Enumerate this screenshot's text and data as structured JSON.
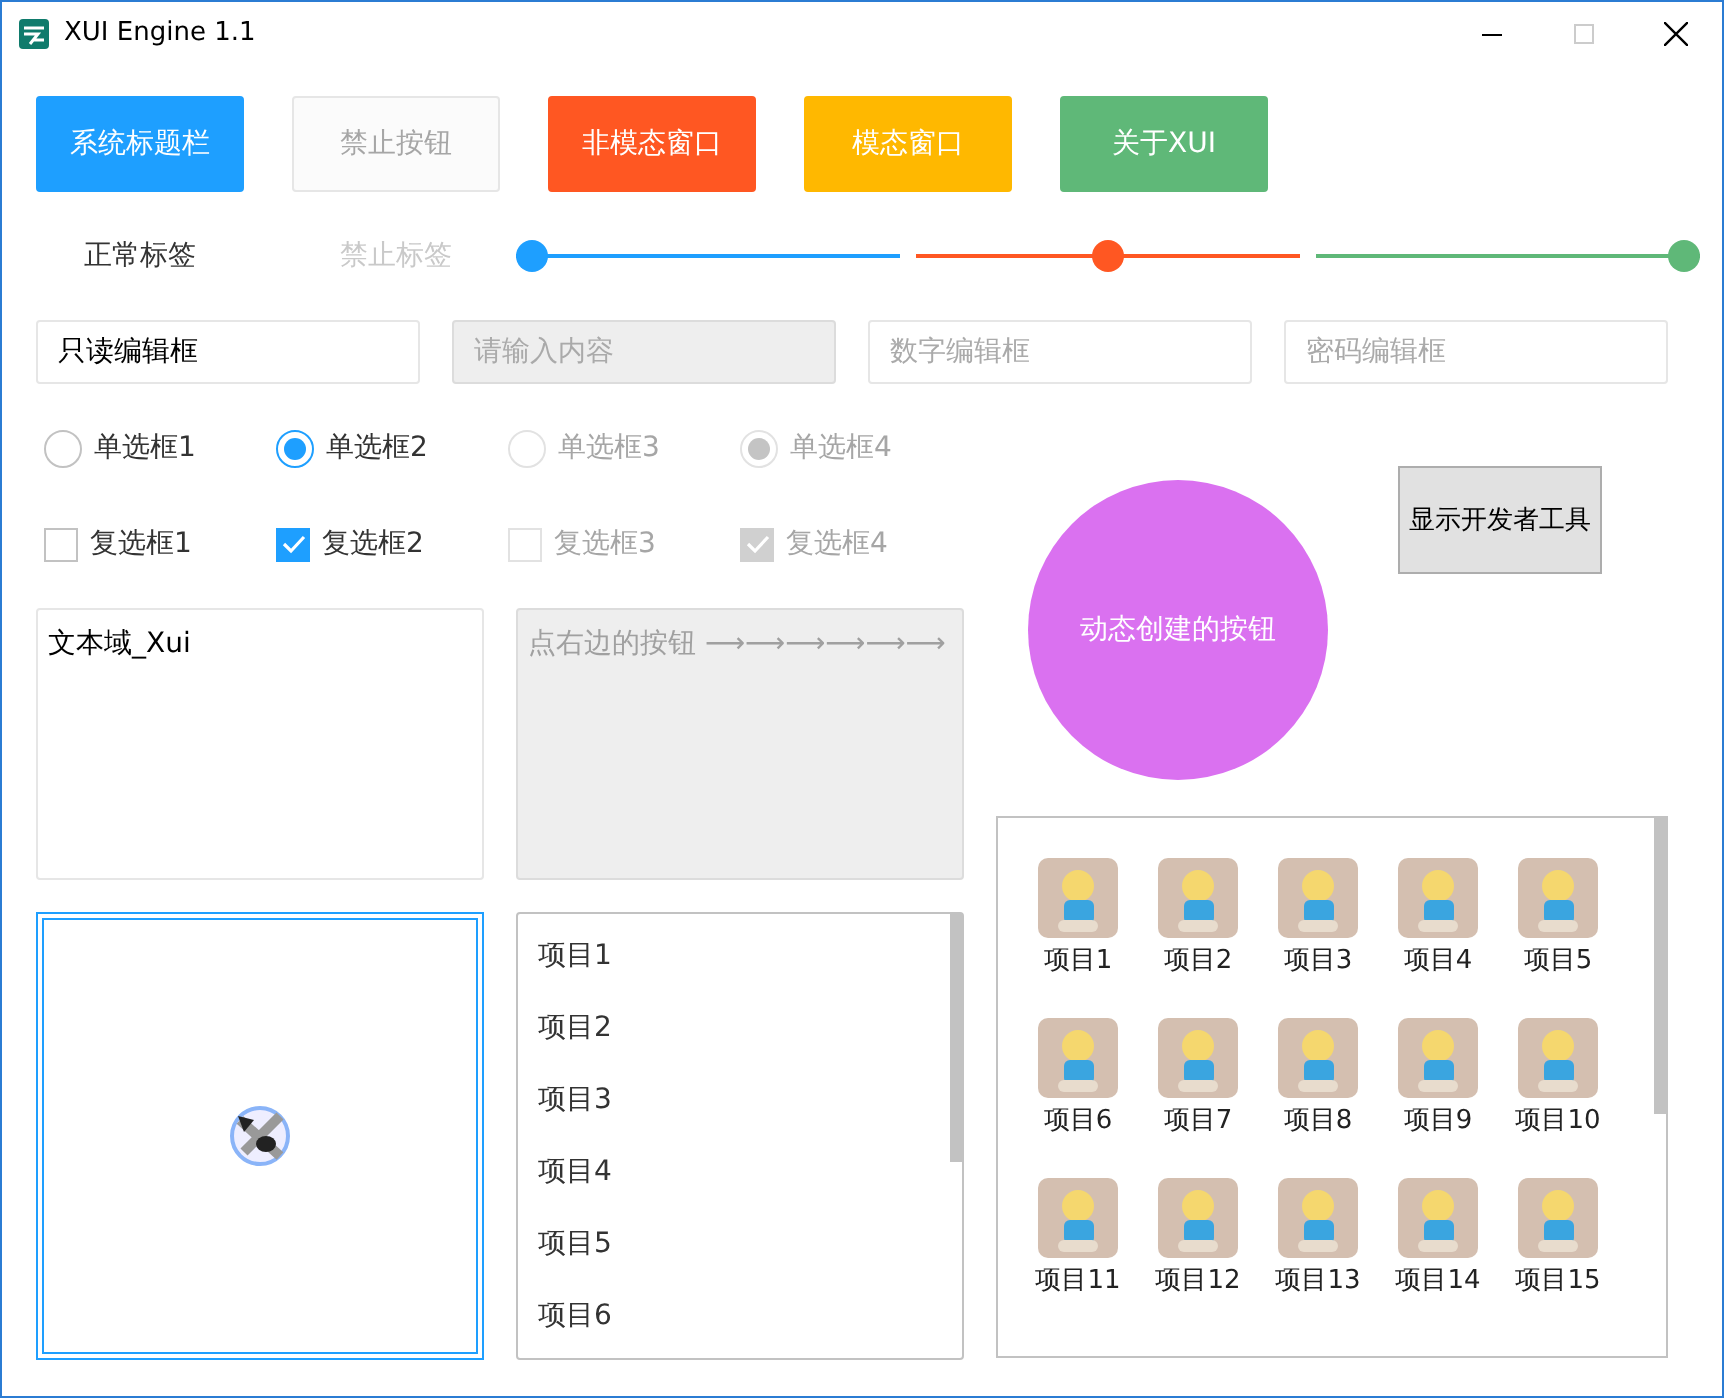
{
  "window": {
    "title": "XUI Engine 1.1"
  },
  "buttons": [
    {
      "label": "系统标题栏",
      "kind": "primary"
    },
    {
      "label": "禁止按钮",
      "kind": "disabled"
    },
    {
      "label": "非模态窗口",
      "kind": "danger"
    },
    {
      "label": "模态窗口",
      "kind": "warm"
    },
    {
      "label": "关于XUI",
      "kind": "success"
    }
  ],
  "labels": [
    {
      "text": "正常标签",
      "disabled": false
    },
    {
      "text": "禁止标签",
      "disabled": true
    }
  ],
  "sliders": [
    {
      "level": 0,
      "color": "#1e9fff"
    },
    {
      "level": 0.5,
      "color": "#ff5722"
    },
    {
      "level": 1,
      "color": "#5fb878"
    }
  ],
  "fields": [
    {
      "value": "只读编辑框",
      "disabled": false
    },
    {
      "placeholder": "请输入内容",
      "disabled": true
    },
    {
      "placeholder": "数字编辑框",
      "disabled": false
    },
    {
      "placeholder": "密码编辑框",
      "disabled": false
    }
  ],
  "radios": [
    {
      "label": "单选框1",
      "selected": false,
      "disabled": false
    },
    {
      "label": "单选框2",
      "selected": true,
      "disabled": false
    },
    {
      "label": "单选框3",
      "selected": false,
      "disabled": true
    },
    {
      "label": "单选框4",
      "selected": true,
      "disabled": true
    }
  ],
  "checkboxes": [
    {
      "label": "复选框1",
      "checked": false,
      "disabled": false
    },
    {
      "label": "复选框2",
      "checked": true,
      "disabled": false
    },
    {
      "label": "复选框3",
      "checked": false,
      "disabled": true
    },
    {
      "label": "复选框4",
      "checked": true,
      "disabled": true
    }
  ],
  "text_areas": [
    {
      "value": "文本域_Xui",
      "disabled": false
    },
    {
      "placeholder": "点右边的按钮 ⟶⟶⟶⟶⟶⟶",
      "disabled": true
    }
  ],
  "list": {
    "items": [
      "项目1",
      "项目2",
      "项目3",
      "项目4",
      "项目5",
      "项目6"
    ]
  },
  "round_button": {
    "label": "动态创建的按钮"
  },
  "dev_button": {
    "label": "显示开发者工具"
  },
  "grid": {
    "items": [
      "项目1",
      "项目2",
      "项目3",
      "项目4",
      "项目5",
      "项目6",
      "项目7",
      "项目8",
      "项目9",
      "项目10",
      "项目11",
      "项目12",
      "项目13",
      "项目14",
      "项目15"
    ]
  }
}
